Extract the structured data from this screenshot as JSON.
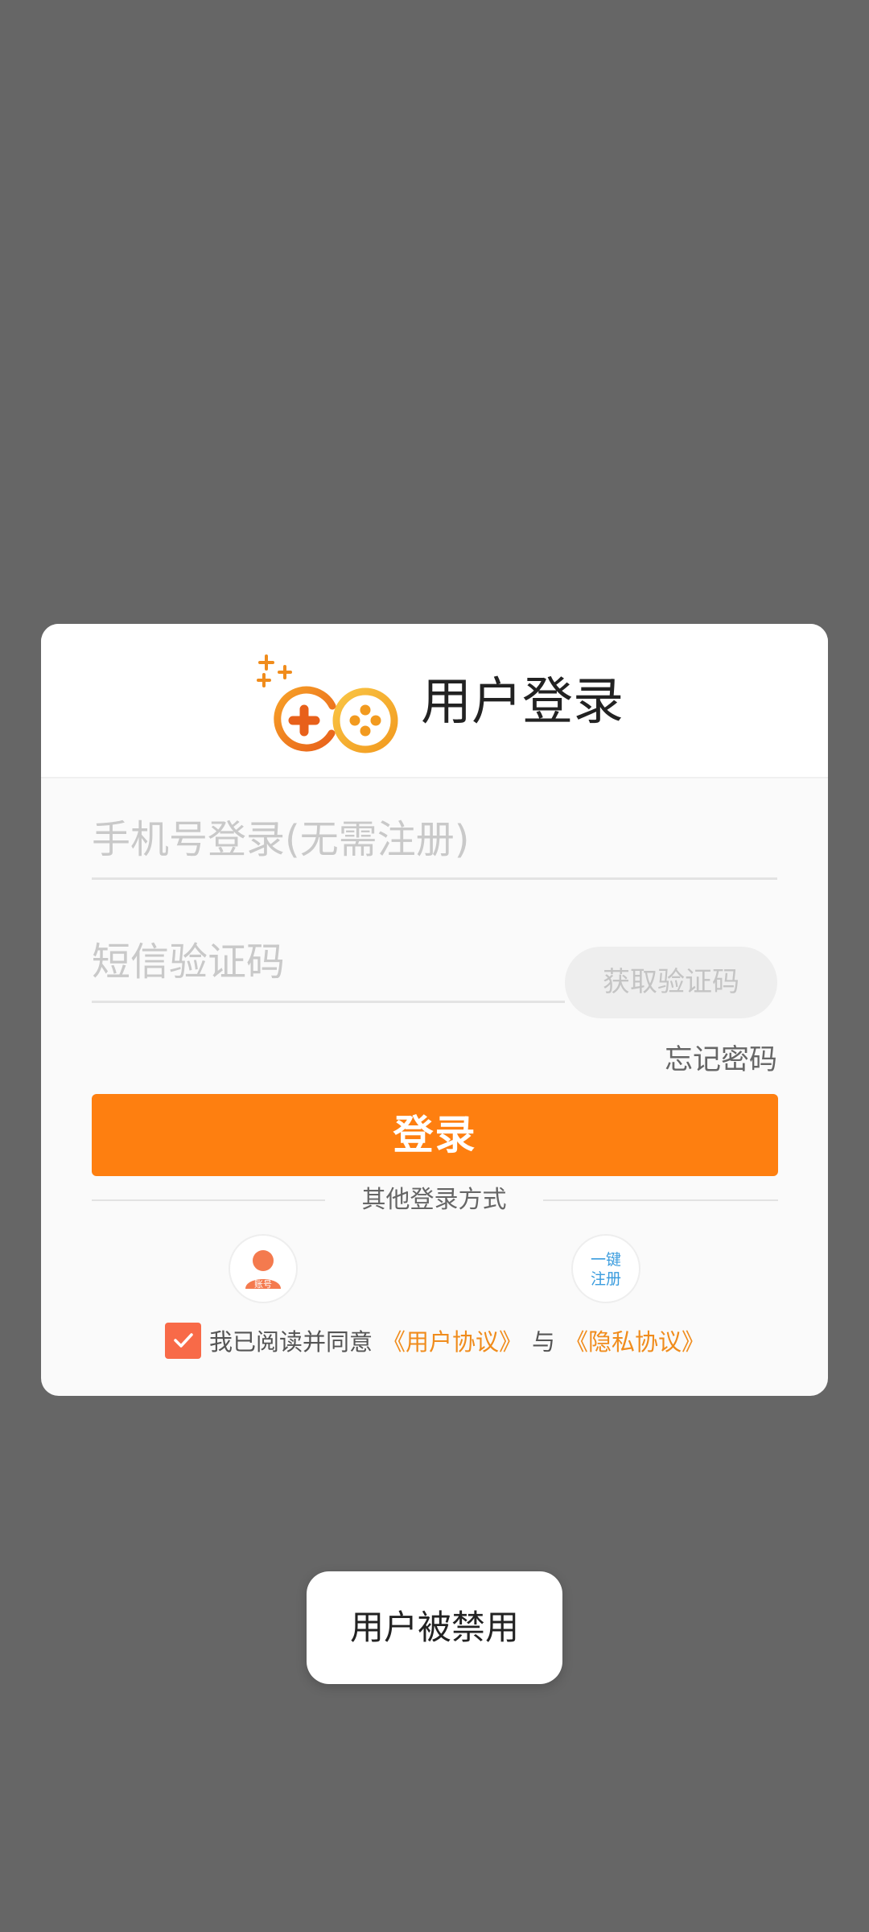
{
  "dialog": {
    "title": "用户登录",
    "logo_icon": "gamepad-logo-icon",
    "phone_placeholder": "手机号登录(无需注册)",
    "code_placeholder": "短信验证码",
    "get_code_label": "获取验证码",
    "forgot_password_label": "忘记密码",
    "login_label": "登录",
    "other_methods_label": "其他登录方式",
    "account_login": {
      "icon": "user-icon",
      "badge": "账号"
    },
    "one_key_register": {
      "line1": "一键",
      "line2": "注册"
    },
    "agreement": {
      "checked": true,
      "prefix": "我已阅读并同意",
      "user_agreement": "《用户协议》",
      "conjunction": "与",
      "privacy_agreement": "《隐私协议》"
    }
  },
  "toast": {
    "message": "用户被禁用"
  },
  "colors": {
    "primary": "#fe7f10",
    "link": "#f08c1c",
    "checkbox": "#f86a48",
    "overlay": "#666666",
    "register_text": "#3a9cde"
  }
}
